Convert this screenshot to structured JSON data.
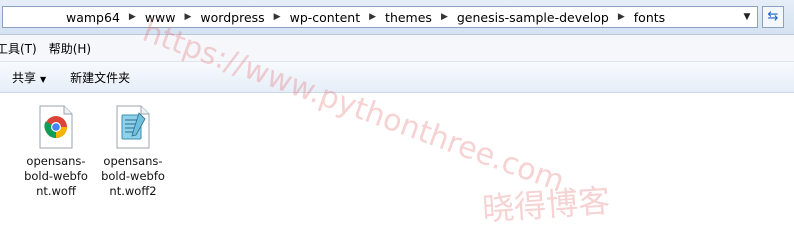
{
  "address": {
    "crumbs": [
      "wamp64",
      "www",
      "wordpress",
      "wp-content",
      "themes",
      "genesis-sample-develop",
      "fonts"
    ]
  },
  "menu": {
    "items": [
      "工具(T)",
      "帮助(H)"
    ]
  },
  "toolbar": {
    "share_label": "共享",
    "new_folder_label": "新建文件夹"
  },
  "files": [
    {
      "name": "opensans-bold-webfont.woff",
      "icon": "chrome-icon"
    },
    {
      "name": "opensans-bold-webfont.woff2",
      "icon": "document-icon"
    }
  ],
  "watermark": {
    "url": "https://www.pythonthree.com",
    "brand": "晓得博客"
  },
  "colors": {
    "watermark": "#e06060",
    "toolbar": "#e7eef8"
  }
}
